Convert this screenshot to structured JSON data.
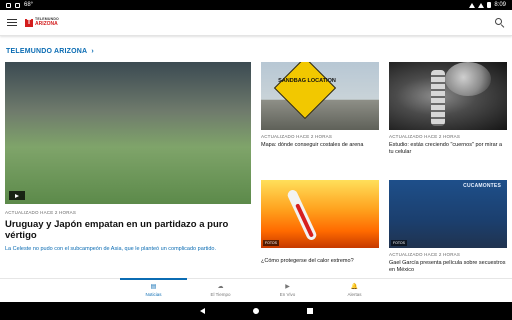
{
  "status_bar": {
    "left_icons": [
      "app-icon",
      "weather-icon"
    ],
    "temperature": "68°",
    "time": "8:09"
  },
  "app_bar": {
    "logo_line1": "TELEMUNDO",
    "logo_line2": "ARIZONA"
  },
  "section": {
    "title": "TELEMUNDO ARIZONA",
    "chevron": "›"
  },
  "featured": {
    "meta": "ACTUALIZADO HACE 2 HORAS",
    "title": "Uruguay y Japón empatan en un partidazo a puro vértigo",
    "description": "La Celeste no pudo con el subcampeón de Asia, que le planteó un complicado partido."
  },
  "cards": [
    {
      "image_text": "SANDBAG LOCATION",
      "meta": "ACTUALIZADO HACE 2 HORAS",
      "title": "Mapa: dónde conseguir costales de arena"
    },
    {
      "meta": "ACTUALIZADO HACE 2 HORAS",
      "title": "Estudio: estás creciendo \"cuernos\" por mirar a tu celular"
    },
    {
      "badge": "FOTOS",
      "title": "¿Cómo protegerse del calor extremo?"
    },
    {
      "image_text": "CUCAMONTES",
      "badge": "FOTOS",
      "meta": "ACTUALIZADO HACE 2 HORAS",
      "title": "Gael García presenta película sobre secuestros en México"
    }
  ],
  "bottom_nav": [
    {
      "icon": "▤",
      "label": "Noticias"
    },
    {
      "icon": "☁",
      "label": "El Tiempo"
    },
    {
      "icon": "▶",
      "label": "En Vivo"
    },
    {
      "icon": "🔔",
      "label": "Alertas"
    }
  ],
  "colors": {
    "accent": "#0b6cb3",
    "brand_red": "#d31d1d"
  }
}
